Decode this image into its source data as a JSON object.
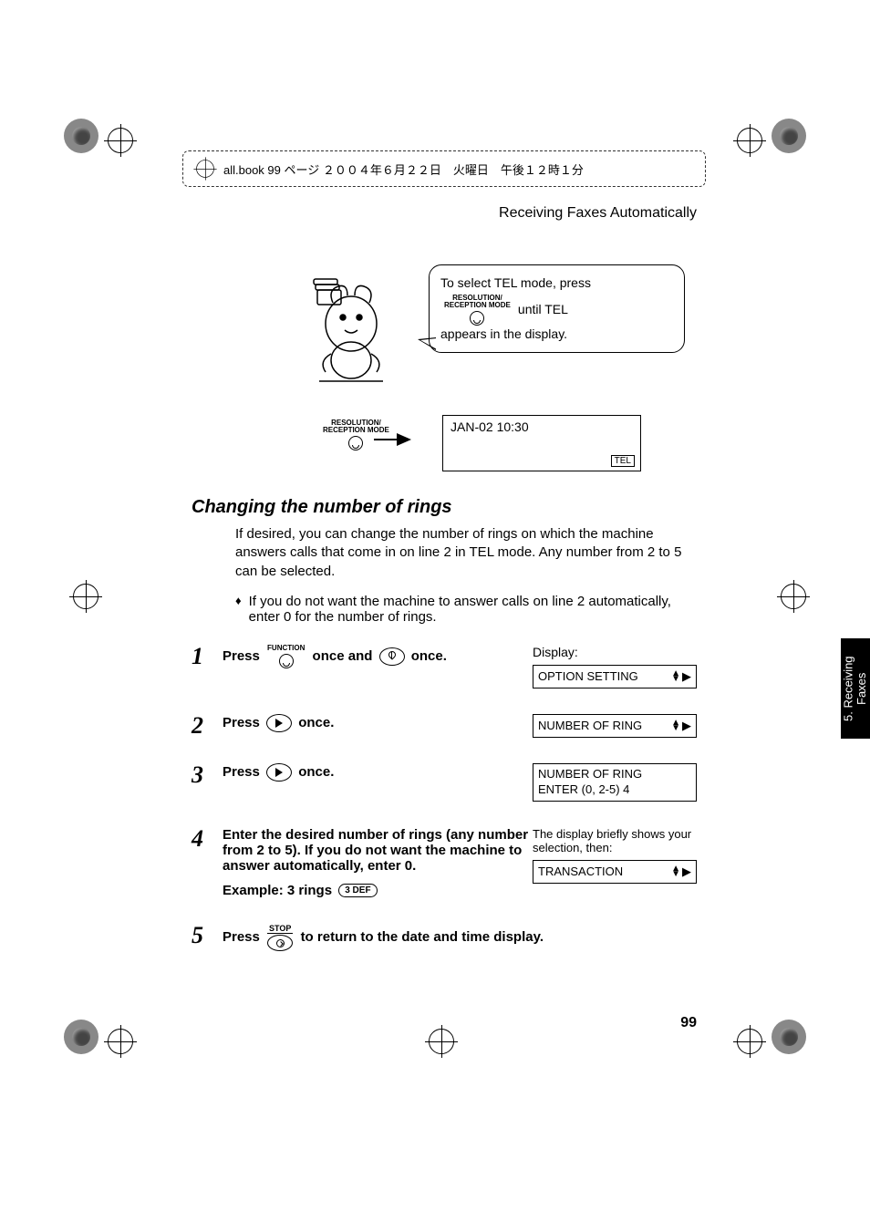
{
  "meta_header": "all.book  99 ページ  ２００４年６月２２日　火曜日　午後１２時１分",
  "running_head": "Receiving Faxes Automatically",
  "bubble": {
    "line1": "To select TEL mode, press",
    "btn_label_top": "RESOLUTION/",
    "btn_label_bottom": "RECEPTION MODE",
    "line2_after_btn": " until TEL",
    "line3": "appears in the display."
  },
  "lcd_preview": {
    "btn_label_top": "RESOLUTION/",
    "btn_label_bottom": "RECEPTION MODE",
    "line1": "JAN-02 10:30",
    "mode_tag": "TEL"
  },
  "section_title": "Changing the number of rings",
  "paragraph": "If desired, you can change the number of rings on which the machine answers calls that come in on line 2 in TEL mode. Any number from 2 to 5 can be selected.",
  "bullet_text": "If you do not want the machine to answer calls on line 2 automatically, enter 0 for the number of rings.",
  "bullet_strong": "0",
  "steps": {
    "s1": {
      "num": "1",
      "pre": "Press ",
      "btn_top": "FUNCTION",
      "mid": " once and ",
      "post": " once.",
      "display_label": "Display:",
      "display_text": "OPTION SETTING"
    },
    "s2": {
      "num": "2",
      "pre": "Press ",
      "post": " once.",
      "display_text": "NUMBER OF RING"
    },
    "s3": {
      "num": "3",
      "pre": "Press ",
      "post": " once.",
      "display_line1": "NUMBER OF RING",
      "display_line2": "ENTER (0, 2-5) 4"
    },
    "s4": {
      "num": "4",
      "text": "Enter the desired number of rings (any number from 2 to 5). If you do not want the machine to answer automatically, enter 0.",
      "example_label": "Example: 3 rings",
      "key_label": "3 DEF",
      "r_intro": "The display briefly shows your selection, then:",
      "display_text": "TRANSACTION"
    },
    "s5": {
      "num": "5",
      "pre": "Press ",
      "stop_label": "STOP",
      "post": " to return to the date and time display."
    }
  },
  "side_tab": "5. Receiving Faxes",
  "page_number": "99"
}
